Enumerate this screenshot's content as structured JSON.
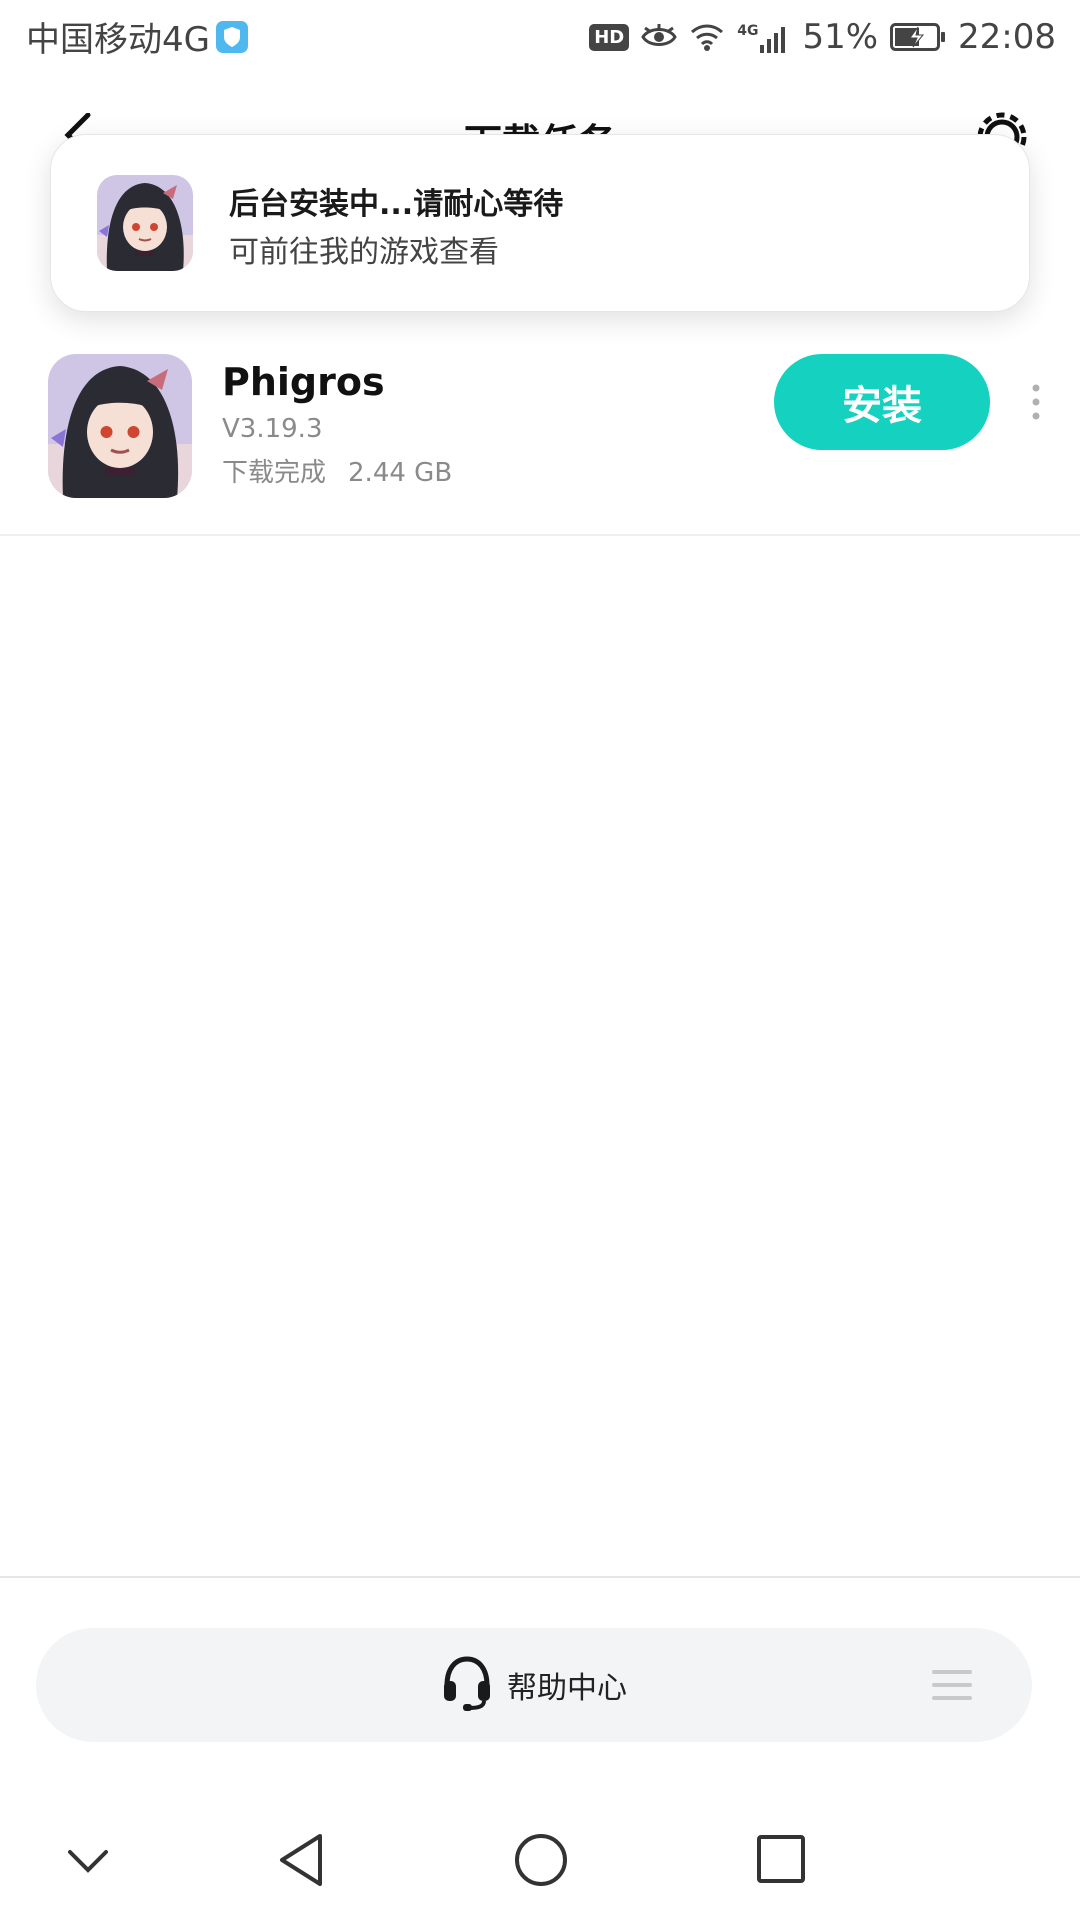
{
  "status_bar": {
    "carrier": "中国移动4G",
    "hd": "HD",
    "network": "4G",
    "battery": "51%",
    "time": "22:08"
  },
  "header": {
    "title": "下载任务"
  },
  "toast": {
    "title": "后台安装中...请耐心等待",
    "subtitle": "可前往我的游戏查看"
  },
  "downloads": [
    {
      "name": "Phigros",
      "version": "V3.19.3",
      "status": "下载完成",
      "size": "2.44 GB",
      "action": "安装"
    }
  ],
  "help": {
    "label": "帮助中心"
  },
  "colors": {
    "accent": "#14d2bf",
    "help_bg": "#f3f4f6",
    "shield": "#4fb8ef"
  }
}
